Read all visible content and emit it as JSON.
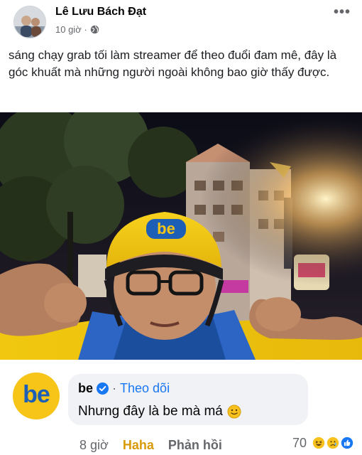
{
  "post": {
    "author": "Lê Lưu Bách Đạt",
    "time": "10 giờ ·",
    "more_label": "•••",
    "caption": "sáng chạy grab tối làm streamer để theo đuổi đam mê, đây là góc khuất mà những người ngoài không bao giờ thấy được.",
    "privacy_icon": "globe-icon"
  },
  "photo": {
    "helmet_logo": "be",
    "accent_color": "#f6c517",
    "brand_blue": "#1d5fb7"
  },
  "comment": {
    "avatar_logo": "be",
    "name": "be",
    "separator": "·",
    "follow_label": "Theo dõi",
    "text": "Nhưng đây là be mà má",
    "time": "8 giờ",
    "haha_label": "Haha",
    "reply_label": "Phản hồi",
    "reaction_count": "70",
    "reaction_icons": [
      "haha-icon",
      "sad-icon",
      "like-icon"
    ]
  }
}
